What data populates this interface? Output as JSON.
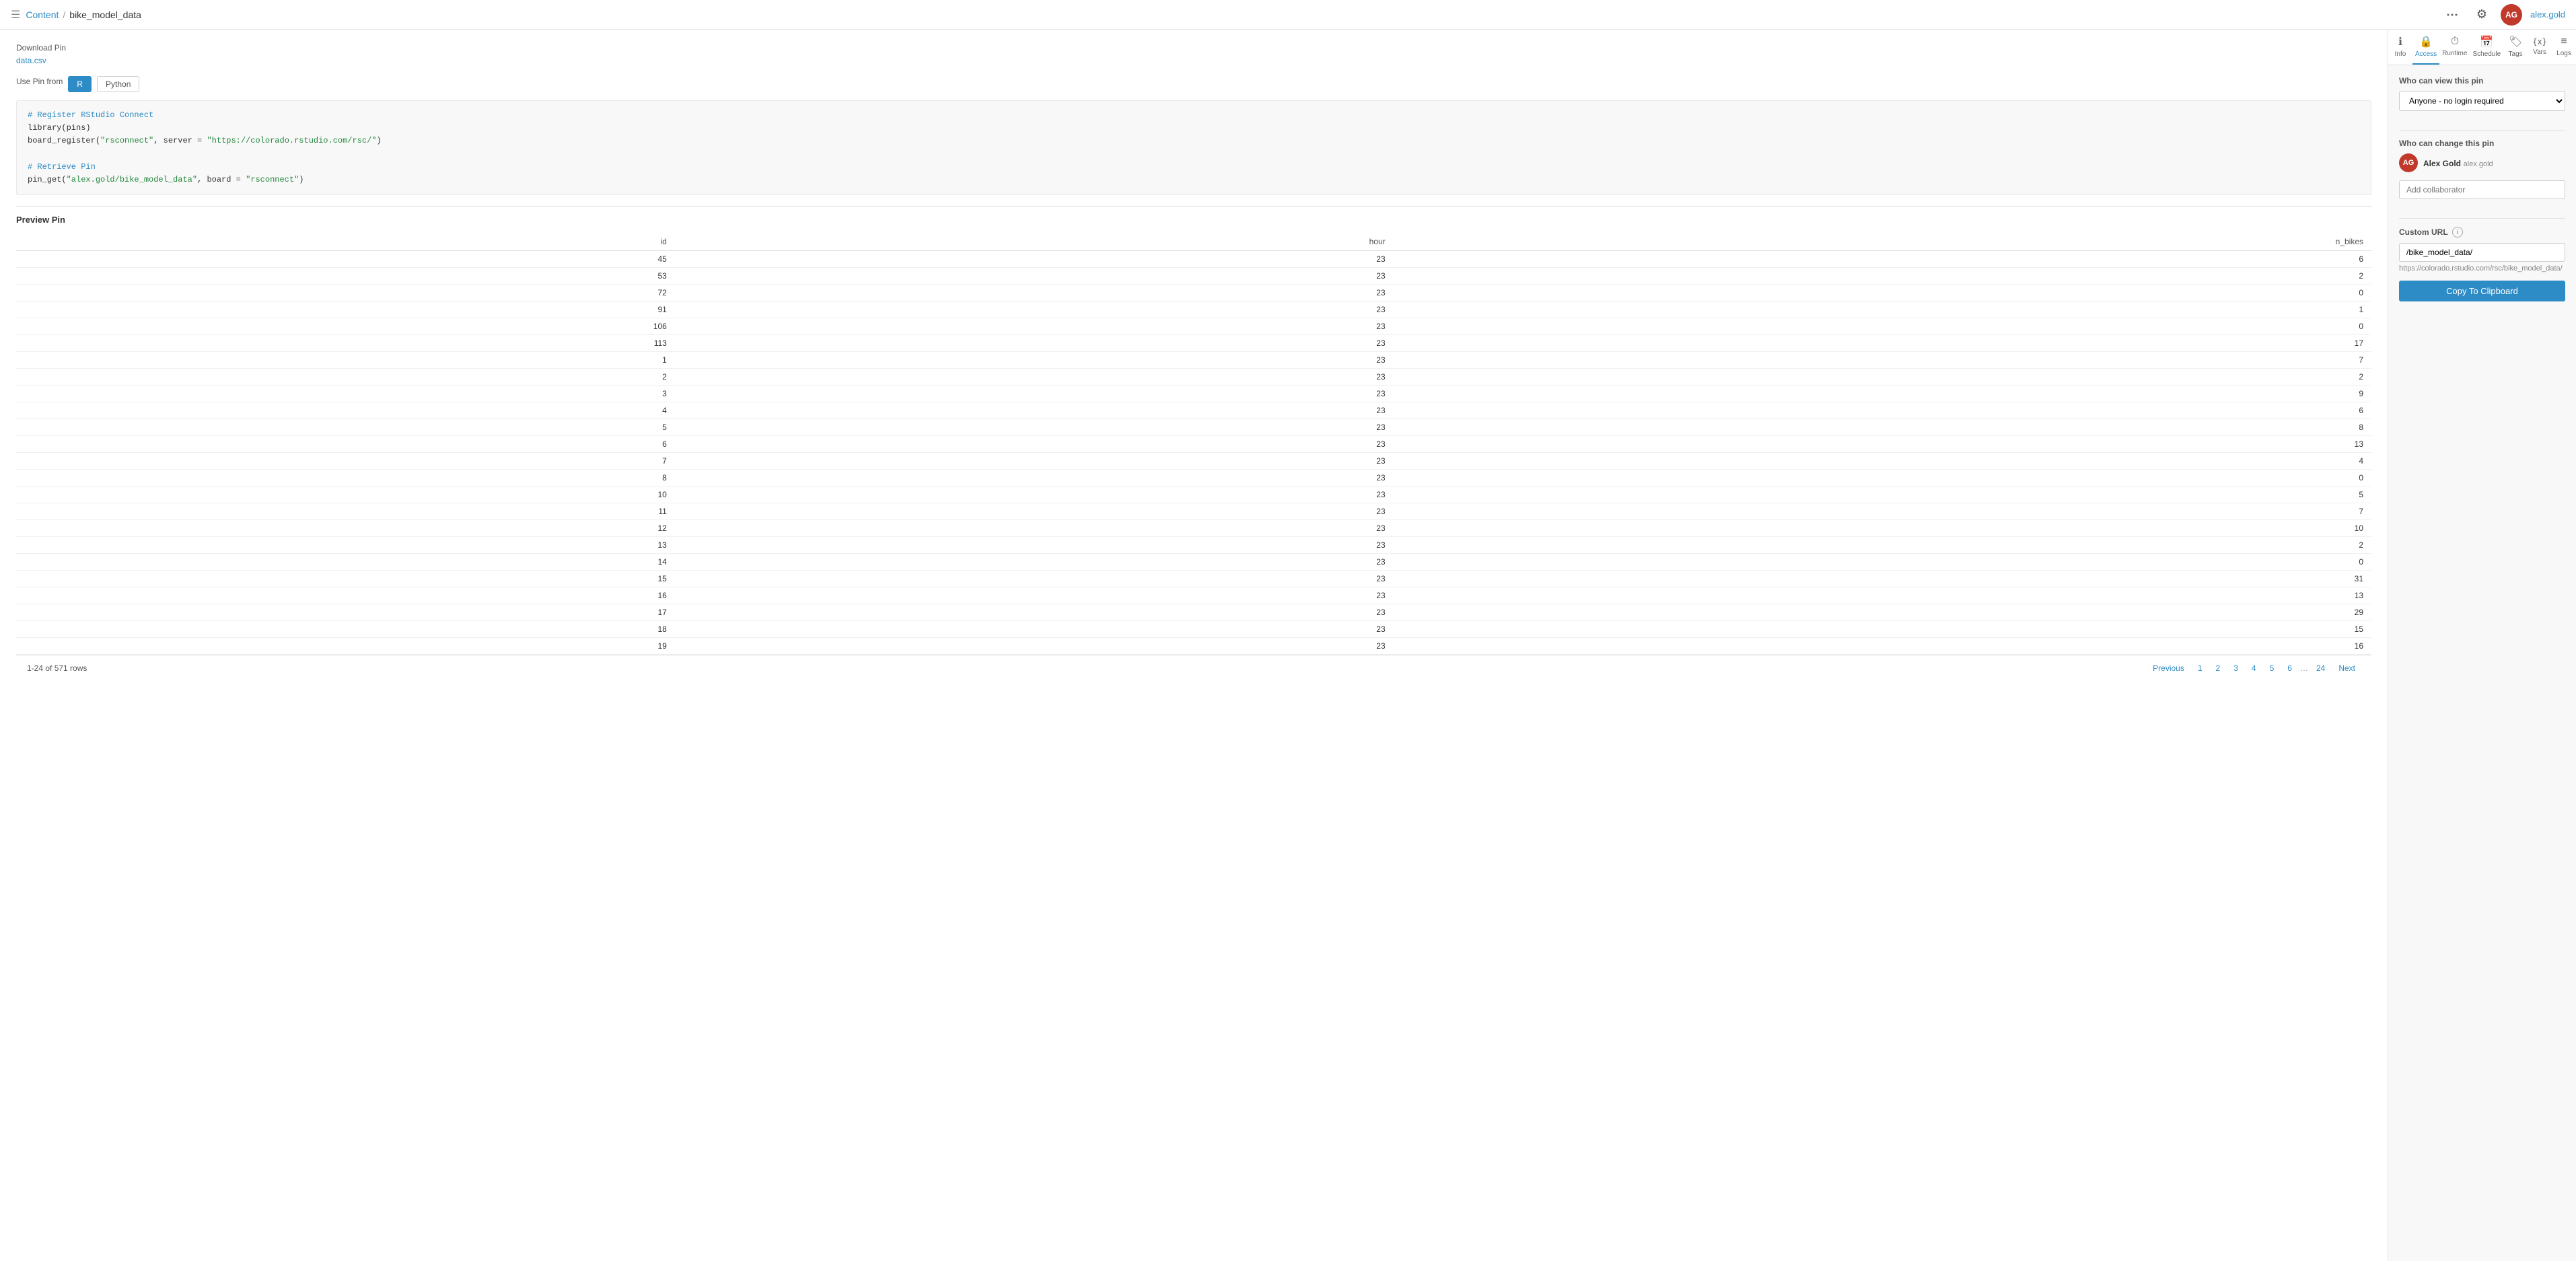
{
  "header": {
    "breadcrumb_root": "Content",
    "breadcrumb_page": "bike_model_data",
    "username": "alex.gold"
  },
  "sidebar_tabs": [
    {
      "id": "info",
      "label": "Info",
      "icon": "ℹ"
    },
    {
      "id": "access",
      "label": "Access",
      "icon": "🔒",
      "active": true
    },
    {
      "id": "runtime",
      "label": "Runtime",
      "icon": "⏱"
    },
    {
      "id": "schedule",
      "label": "Schedule",
      "icon": "📅"
    },
    {
      "id": "tags",
      "label": "Tags",
      "icon": "🏷"
    },
    {
      "id": "vars",
      "label": "Vars",
      "icon": "{x}"
    },
    {
      "id": "logs",
      "label": "Logs",
      "icon": "≡"
    }
  ],
  "access": {
    "view_label": "Who can view this pin",
    "view_value": "Anyone - no login required",
    "change_label": "Who can change this pin",
    "collaborator_name": "Alex Gold",
    "collaborator_login": "alex.gold",
    "collaborator_initials": "AG",
    "add_collab_placeholder": "Add collaborator",
    "custom_url_label": "Custom URL",
    "custom_url_value": "/bike_model_data/",
    "url_preview": "https://colorado.rstudio.com/rsc/bike_model_data/",
    "copy_btn": "Copy To Clipboard"
  },
  "download_pin": {
    "label": "Download Pin",
    "link_text": "data.csv"
  },
  "use_pin": {
    "label": "Use Pin from",
    "lang_r": "R",
    "lang_python": "Python",
    "code_lines": [
      "# Register RStudio Connect",
      "library(pins)",
      "board_register(\"rsconnect\", server = \"https://colorado.rstudio.com/rsc/\")",
      "",
      "# Retrieve Pin",
      "pin_get(\"alex.gold/bike_model_data\", board = \"rsconnect\")"
    ]
  },
  "preview": {
    "label": "Preview Pin",
    "columns": [
      "id",
      "hour",
      "n_bikes"
    ],
    "rows": [
      [
        45,
        23,
        6
      ],
      [
        53,
        23,
        2
      ],
      [
        72,
        23,
        0
      ],
      [
        91,
        23,
        1
      ],
      [
        106,
        23,
        0
      ],
      [
        113,
        23,
        17
      ],
      [
        1,
        23,
        7
      ],
      [
        2,
        23,
        2
      ],
      [
        3,
        23,
        9
      ],
      [
        4,
        23,
        6
      ],
      [
        5,
        23,
        8
      ],
      [
        6,
        23,
        13
      ],
      [
        7,
        23,
        4
      ],
      [
        8,
        23,
        0
      ],
      [
        10,
        23,
        5
      ],
      [
        11,
        23,
        7
      ],
      [
        12,
        23,
        10
      ],
      [
        13,
        23,
        2
      ],
      [
        14,
        23,
        0
      ],
      [
        15,
        23,
        31
      ],
      [
        16,
        23,
        13
      ],
      [
        17,
        23,
        29
      ],
      [
        18,
        23,
        15
      ],
      [
        19,
        23,
        16
      ]
    ]
  },
  "pagination": {
    "summary": "1-24 of 571 rows",
    "prev_label": "Previous",
    "next_label": "Next",
    "pages": [
      "1",
      "2",
      "3",
      "4",
      "5",
      "6",
      "...",
      "24"
    ]
  }
}
